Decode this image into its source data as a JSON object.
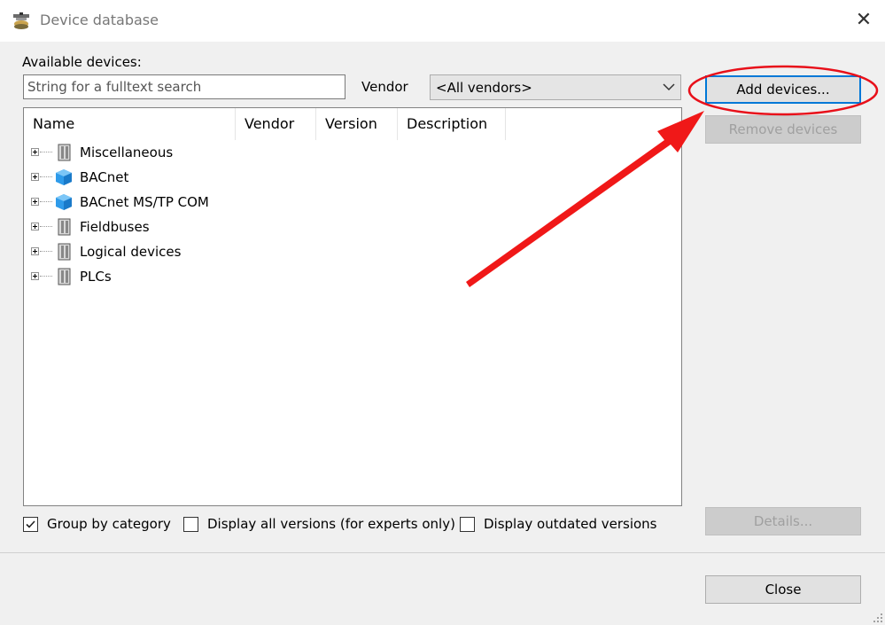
{
  "window": {
    "title": "Device database",
    "icon": "device-database-icon",
    "close_glyph": "✕"
  },
  "search": {
    "label": "Available devices:",
    "placeholder": "String for a fulltext search",
    "value": ""
  },
  "vendor": {
    "label": "Vendor",
    "selected": "<All vendors>"
  },
  "tree": {
    "columns": [
      "Name",
      "Vendor",
      "Version",
      "Description"
    ],
    "items": [
      {
        "label": "Miscellaneous",
        "icon": "device-cabinet-icon"
      },
      {
        "label": "BACnet",
        "icon": "bacnet-cube-icon"
      },
      {
        "label": "BACnet MS/TP COM",
        "icon": "bacnet-cube-icon"
      },
      {
        "label": "Fieldbuses",
        "icon": "device-cabinet-icon"
      },
      {
        "label": "Logical devices",
        "icon": "device-cabinet-icon"
      },
      {
        "label": "PLCs",
        "icon": "device-cabinet-icon"
      }
    ]
  },
  "buttons": {
    "add": "Add devices...",
    "remove": "Remove devices",
    "details": "Details...",
    "close": "Close"
  },
  "options": [
    {
      "label": "Group by category",
      "checked": true
    },
    {
      "label": "Display all versions (for experts only)",
      "checked": false
    },
    {
      "label": "Display outdated versions",
      "checked": false
    }
  ],
  "colors": {
    "accent": "#0078d7",
    "annotation": "#e8101a"
  }
}
